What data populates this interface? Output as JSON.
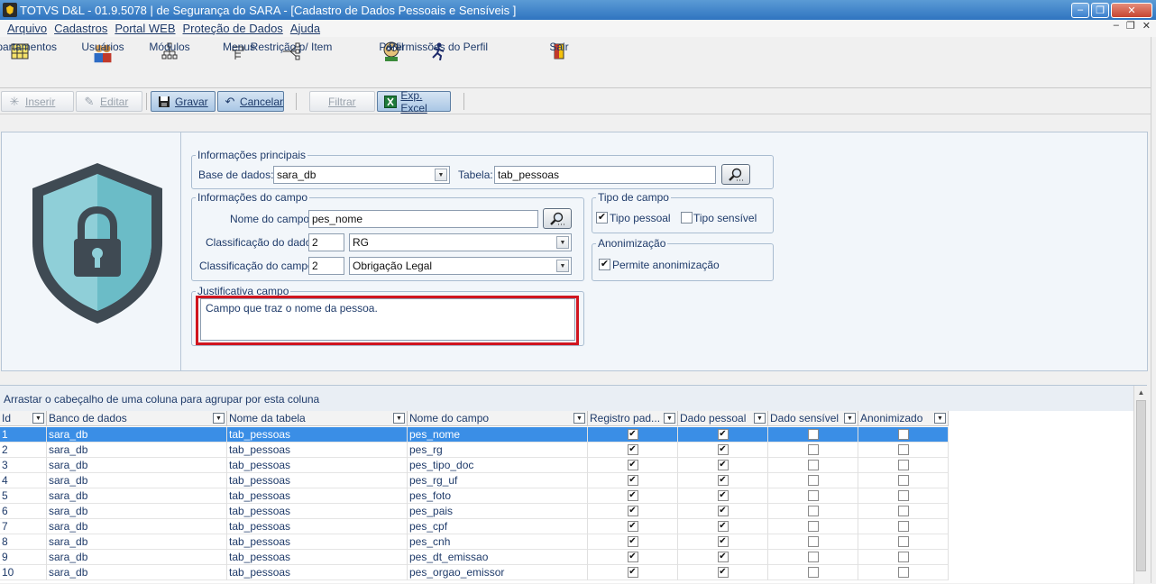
{
  "window": {
    "title": "TOTVS D&L - 01.9.5078 | de Segurança do SARA - [Cadastro de Dados Pessoais e Sensíveis ]",
    "min": "‒",
    "max": "❐",
    "close": "✕"
  },
  "menu": {
    "items": [
      "Arquivo",
      "Cadastros",
      "Portal WEB",
      "Proteção de Dados",
      "Ajuda"
    ],
    "mdi": [
      "‒",
      "❐",
      "✕"
    ]
  },
  "ribbon": [
    {
      "label": "Departamentos",
      "icon": "table-grid-icon"
    },
    {
      "label": "Usuários",
      "icon": "users-icon"
    },
    {
      "label": "Módulos",
      "icon": "modules-tree-icon"
    },
    {
      "label": "Menus",
      "icon": "menu-icon"
    },
    {
      "label": "Restrição p/ Item",
      "icon": "restriction-icon"
    },
    {
      "label": "Perfil",
      "icon": "profile-icon"
    },
    {
      "label": "Permissões do Perfil",
      "icon": "permissions-icon"
    },
    {
      "label": "Sair",
      "icon": "exit-door-icon"
    }
  ],
  "toolbar": {
    "inserir": "Inserir",
    "editar": "Editar",
    "gravar": "Gravar",
    "cancelar": "Cancelar",
    "filtrar": "Filtrar",
    "exp_excel": "Exp. Excel"
  },
  "form": {
    "main_group": "Informações principais",
    "base_label": "Base de dados:",
    "base_value": "sara_db",
    "tabela_label": "Tabela:",
    "tabela_value": "tab_pessoas",
    "field_group": "Informações do campo",
    "nome_label": "Nome do campo:",
    "nome_value": "pes_nome",
    "class_dado_label": "Classificação do dado:",
    "class_dado_code": "2",
    "class_dado_value": "RG",
    "class_campo_label": "Classificação do campo:",
    "class_campo_code": "2",
    "class_campo_value": "Obrigação Legal",
    "tipo_group": "Tipo de campo",
    "tipo_pessoal": "Tipo pessoal",
    "tipo_pessoal_checked": true,
    "tipo_sensivel": "Tipo sensível",
    "tipo_sensivel_checked": false,
    "anon_group": "Anonimização",
    "permite_anon": "Permite anonimização",
    "permite_anon_checked": true,
    "just_group": "Justificativa campo",
    "just_value": "Campo que traz o nome da pessoa."
  },
  "grid": {
    "group_hint": "Arrastar o cabeçalho de uma coluna para agrupar por esta coluna",
    "columns": [
      "Id",
      "Banco de dados",
      "Nome da tabela",
      "Nome do campo",
      "Registro pad...",
      "Dado pessoal",
      "Dado sensível",
      "Anonimizado"
    ],
    "rows": [
      {
        "id": "1",
        "db": "sara_db",
        "table": "tab_pessoas",
        "field": "pes_nome",
        "reg": true,
        "pessoal": true,
        "sensivel": false,
        "anon": false
      },
      {
        "id": "2",
        "db": "sara_db",
        "table": "tab_pessoas",
        "field": "pes_rg",
        "reg": true,
        "pessoal": true,
        "sensivel": false,
        "anon": false
      },
      {
        "id": "3",
        "db": "sara_db",
        "table": "tab_pessoas",
        "field": "pes_tipo_doc",
        "reg": true,
        "pessoal": true,
        "sensivel": false,
        "anon": false
      },
      {
        "id": "4",
        "db": "sara_db",
        "table": "tab_pessoas",
        "field": "pes_rg_uf",
        "reg": true,
        "pessoal": true,
        "sensivel": false,
        "anon": false
      },
      {
        "id": "5",
        "db": "sara_db",
        "table": "tab_pessoas",
        "field": "pes_foto",
        "reg": true,
        "pessoal": true,
        "sensivel": false,
        "anon": false
      },
      {
        "id": "6",
        "db": "sara_db",
        "table": "tab_pessoas",
        "field": "pes_pais",
        "reg": true,
        "pessoal": true,
        "sensivel": false,
        "anon": false
      },
      {
        "id": "7",
        "db": "sara_db",
        "table": "tab_pessoas",
        "field": "pes_cpf",
        "reg": true,
        "pessoal": true,
        "sensivel": false,
        "anon": false
      },
      {
        "id": "8",
        "db": "sara_db",
        "table": "tab_pessoas",
        "field": "pes_cnh",
        "reg": true,
        "pessoal": true,
        "sensivel": false,
        "anon": false
      },
      {
        "id": "9",
        "db": "sara_db",
        "table": "tab_pessoas",
        "field": "pes_dt_emissao",
        "reg": true,
        "pessoal": true,
        "sensivel": false,
        "anon": false
      },
      {
        "id": "10",
        "db": "sara_db",
        "table": "tab_pessoas",
        "field": "pes_orgao_emissor",
        "reg": true,
        "pessoal": true,
        "sensivel": false,
        "anon": false
      }
    ]
  }
}
